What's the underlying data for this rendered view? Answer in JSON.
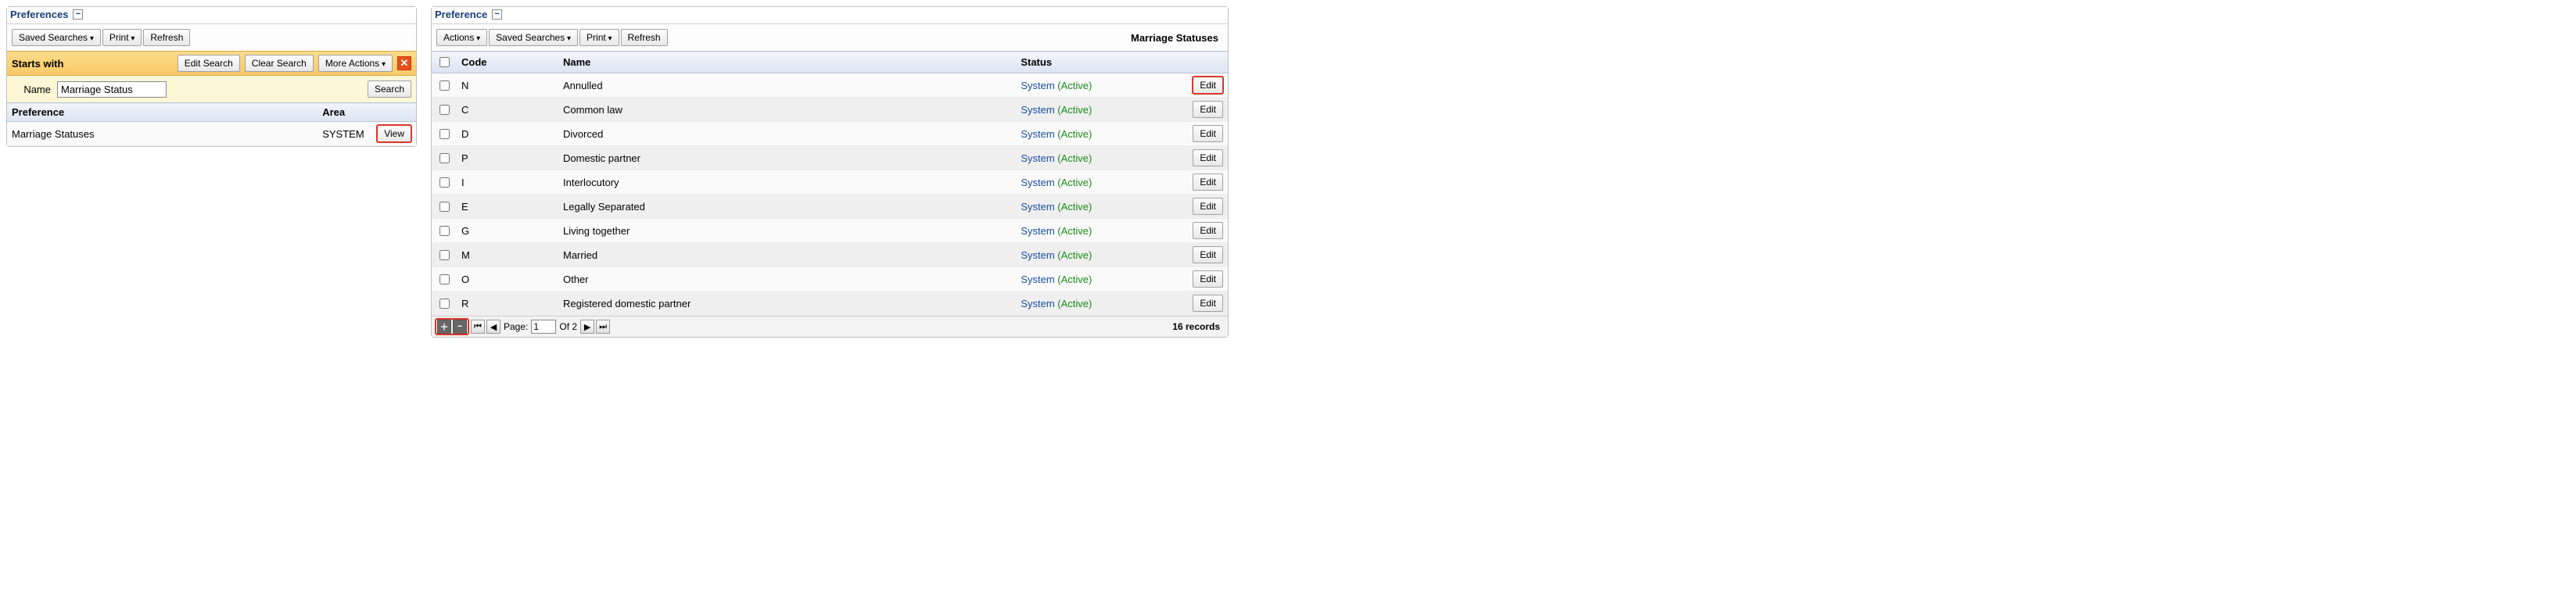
{
  "left": {
    "title": "Preferences",
    "toolbar": {
      "saved_searches": "Saved Searches",
      "print": "Print",
      "refresh": "Refresh"
    },
    "search_strip": {
      "label": "Starts with",
      "edit_search": "Edit Search",
      "clear_search": "Clear Search",
      "more_actions": "More Actions"
    },
    "filter": {
      "name_label": "Name",
      "name_value": "Marriage Status",
      "search_btn": "Search"
    },
    "grid": {
      "col_preference": "Preference",
      "col_area": "Area",
      "rows": [
        {
          "preference": "Marriage Statuses",
          "area": "SYSTEM",
          "view": "View"
        }
      ]
    }
  },
  "right": {
    "title": "Preference",
    "toolbar": {
      "actions": "Actions",
      "saved_searches": "Saved Searches",
      "print": "Print",
      "refresh": "Refresh",
      "heading": "Marriage Statuses"
    },
    "grid": {
      "col_code": "Code",
      "col_name": "Name",
      "col_status": "Status",
      "status_link": "System",
      "status_state": "(Active)",
      "edit": "Edit",
      "rows": [
        {
          "code": "N",
          "name": "Annulled"
        },
        {
          "code": "C",
          "name": "Common law"
        },
        {
          "code": "D",
          "name": "Divorced"
        },
        {
          "code": "P",
          "name": "Domestic partner"
        },
        {
          "code": "I",
          "name": "Interlocutory"
        },
        {
          "code": "E",
          "name": "Legally Separated"
        },
        {
          "code": "G",
          "name": "Living together"
        },
        {
          "code": "M",
          "name": "Married"
        },
        {
          "code": "O",
          "name": "Other"
        },
        {
          "code": "R",
          "name": "Registered domestic partner"
        }
      ]
    },
    "pager": {
      "page_label": "Page:",
      "page_value": "1",
      "of_label": "Of 2",
      "records": "16 records"
    }
  }
}
